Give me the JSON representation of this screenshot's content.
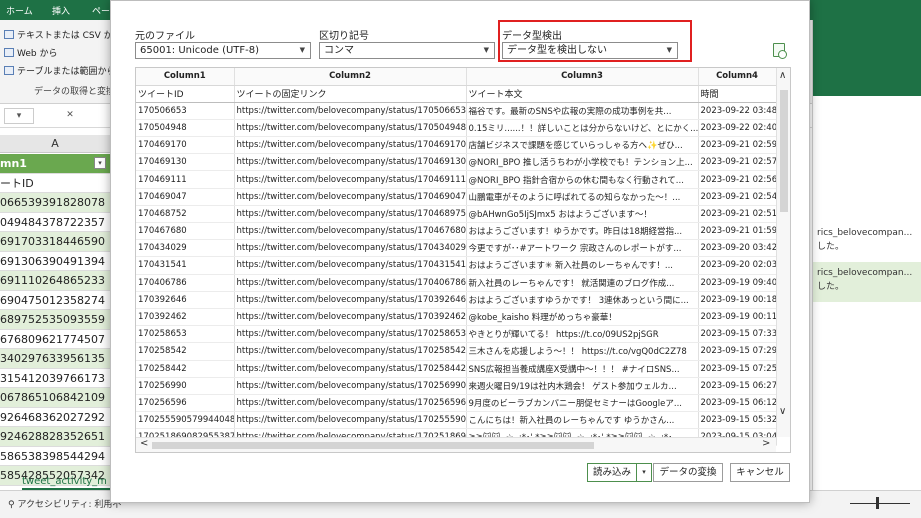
{
  "excel": {
    "tabs": [
      "ホーム",
      "挿入",
      "ペー"
    ],
    "ribbon_items": [
      "テキストまたは CSV から",
      "Web から",
      "テーブルまたは範囲から"
    ],
    "ribbon_group": "データの取得と変換",
    "name_box_arrow": "▾",
    "cancel_mark": "✕",
    "column_letter": "A",
    "grid_header": "mn1",
    "grid_rows": [
      "ートID",
      "066539391828078",
      "049484378722357",
      "691703318446590",
      "691306390491394",
      "691110264865233",
      "690475012358274",
      "689752535093559",
      "676809621774507",
      "340297633956135",
      "315412039766173",
      "067865106842109",
      "926468362027292",
      "924628828352651",
      "586538398544294",
      "585428552057342"
    ],
    "sheet_tab": "tweet_activity_m",
    "accessibility": "アクセシビリティ: 利用不",
    "right_panel": [
      {
        "line1": "rics_belovecompan...",
        "line2": "した。"
      },
      {
        "line1": "rics_belovecompan...",
        "line2": "した。"
      }
    ]
  },
  "dialog": {
    "file_origin_label": "元のファイル",
    "file_origin_value": "65001: Unicode (UTF-8)",
    "delimiter_label": "区切り記号",
    "delimiter_value": "コンマ",
    "type_detect_label": "データ型検出",
    "type_detect_value": "データ型を検出しない",
    "columns": [
      "Column1",
      "Column2",
      "Column3",
      "Column4"
    ],
    "subheaders": [
      "ツイートID",
      "ツイートの固定リンク",
      "ツイート本文",
      "時間"
    ],
    "rows": [
      [
        "170506653",
        "https://twitter.com/belovecompany/status/170506653...",
        "福谷です。最新のSNSや広報の実際の成功事例を共...",
        "2023-09-22 03:48 +"
      ],
      [
        "170504948",
        "https://twitter.com/belovecompany/status/170504948...",
        "0.15ミリ......！！詳しいことは分からないけど、とにかく...",
        "2023-09-22 02:40 +"
      ],
      [
        "170469170",
        "https://twitter.com/belovecompany/status/170469170...",
        "店舗ビジネスで課題を感じていらっしゃる方へ✨ぜひ...",
        "2023-09-21 02:59 +"
      ],
      [
        "170469130",
        "https://twitter.com/belovecompany/status/170469130...",
        "@NORI_BPO 推し活うちわが小学校でも！テンション上...",
        "2023-09-21 02:57 +"
      ],
      [
        "170469111",
        "https://twitter.com/belovecompany/status/170469111...",
        "@NORI_BPO 指針合宿からの休む間もなく行動されて...",
        "2023-09-21 02:56 +"
      ],
      [
        "170469047",
        "https://twitter.com/belovecompany/status/170469047...",
        "山鵬電車がそのように呼ばれてるの知らなかった～！...",
        "2023-09-21 02:54 +"
      ],
      [
        "170468752",
        "https://twitter.com/belovecompany/status/170468975...",
        "@bAHwnGo5IjSJmx5 おはようございます～！",
        "2023-09-21 02:51 +"
      ],
      [
        "170467680",
        "https://twitter.com/belovecompany/status/170467680...",
        "おはようございます！ゆうかです。昨日は18期経営指...",
        "2023-09-21 01:59 +"
      ],
      [
        "170434029",
        "https://twitter.com/belovecompany/status/170434029...",
        "今更ですが･･#アートワーク 宗政さんのレポートがす...",
        "2023-09-20 03:42 +"
      ],
      [
        "170431541",
        "https://twitter.com/belovecompany/status/170431541...",
        "おはようございます✳ 新入社員のレーちゃんです！...",
        "2023-09-20 02:03 +"
      ],
      [
        "170406786",
        "https://twitter.com/belovecompany/status/170406786...",
        "新入社員のレーちゃんです！ 就活関連のブログ作成...",
        "2023-09-19 09:40 +"
      ],
      [
        "170392646",
        "https://twitter.com/belovecompany/status/170392646...",
        "おはようございますゆうかです！ 3連休あっという間に...",
        "2023-09-19 00:18 +"
      ],
      [
        "170392462",
        "https://twitter.com/belovecompany/status/170392462...",
        "@kobe_kaisho 料理がめっちゃ豪華！",
        "2023-09-19 00:11 +"
      ],
      [
        "170258653",
        "https://twitter.com/belovecompany/status/170258653...",
        "やきとりが輝いてる！ https://t.co/09US2pjSGR",
        "2023-09-15 07:33 +"
      ],
      [
        "170258542",
        "https://twitter.com/belovecompany/status/170258542...",
        "三木さんを応援しよう～！！ https://t.co/vgQ0dC2Z78",
        "2023-09-15 07:29 +"
      ],
      [
        "170258442",
        "https://twitter.com/belovecompany/status/170258442...",
        "SNS広報担当養成講座X受講中～！！！ #ナイロSNS...",
        "2023-09-15 07:25 +"
      ],
      [
        "170256990",
        "https://twitter.com/belovecompany/status/170256990...",
        "来週火曜日9/19は社内木鶏会！ ゲスト参加ウェルカ...",
        "2023-09-15 06:27 +"
      ],
      [
        "170256596",
        "https://twitter.com/belovecompany/status/170256596...",
        "9月度のビーラブカンパニー朋促セミナーはGoogleア...",
        "2023-09-15 06:12 +"
      ],
      [
        "170255590579944048",
        "https://twitter.com/belovecompany/status/170255590...",
        "こんにちは！新入社員のレーちゃんです ゆうかさん...",
        "2023-09-15 05:32 +"
      ],
      [
        "1702518690829553877",
        "https://twitter.com/belovecompany/status/170251869...",
        "≷≷🐱🐱 .☆.,:*･'.*≷≷🐱🐱 .☆.,:*･'.*≷≷🐱🐱 .☆.,:*･...",
        "2023-09-15 03:04 +"
      ]
    ],
    "buttons": {
      "load": "読み込み",
      "load_arrow": "▾",
      "transform": "データの変換",
      "cancel": "キャンセル"
    },
    "scroll": {
      "up": "∧",
      "down": "∨",
      "left": "<",
      "right": ">"
    }
  }
}
